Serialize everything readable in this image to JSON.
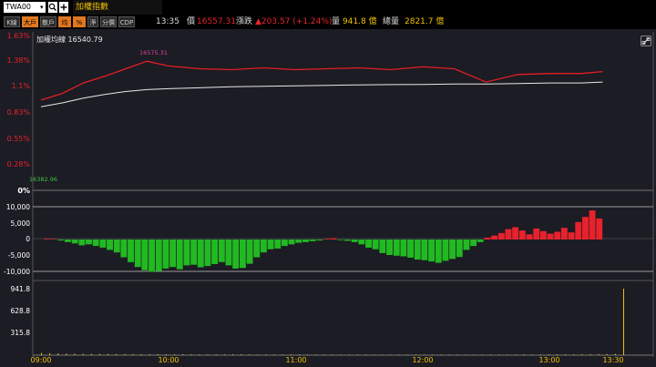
{
  "toolbar": {
    "symbol": "TWA00",
    "dropdown_glyph": "▾",
    "search_icon": "search-icon",
    "add_icon": "plus-icon",
    "index_name": "加權指數",
    "modes": [
      {
        "label": "K線",
        "active": false
      },
      {
        "label": "大戶",
        "active": true
      },
      {
        "label": "散戶",
        "active": false
      },
      {
        "label": "均",
        "active": true
      },
      {
        "label": "%",
        "active": true
      },
      {
        "label": "淨",
        "active": false
      },
      {
        "label": "分價",
        "active": false
      },
      {
        "label": "CDP",
        "active": false
      }
    ]
  },
  "quote": {
    "time": "13:35",
    "price_label": "價",
    "price": "16557.31",
    "change_label": "漲跌",
    "change": "▲203.57 (+1.24%)",
    "volume_label": "量",
    "volume": "941.8 億",
    "total_label": "總量",
    "total": "2821.7 億"
  },
  "colors": {
    "up": "#e8222c",
    "down": "#22b922",
    "line": "#e31e24",
    "avg": "#e8e8e8",
    "accent": "#f0c000"
  },
  "chart_data": [
    {
      "type": "line",
      "legend": "加權均線 16540.79",
      "y_ticks": [
        "1.63%",
        "1.38%",
        "1.1%",
        "0.83%",
        "0.55%",
        "0.28%"
      ],
      "baseline_label": "0%",
      "annotations": {
        "high": "16575.31",
        "low": "16382.96"
      },
      "x_ticks": [
        "09:00",
        "10:00",
        "11:00",
        "12:00",
        "13:00",
        "13:30"
      ],
      "series": [
        {
          "name": "加權指數",
          "x": [
            "09:00",
            "09:10",
            "09:20",
            "09:30",
            "09:40",
            "09:50",
            "10:00",
            "10:15",
            "10:30",
            "10:45",
            "11:00",
            "11:15",
            "11:30",
            "11:45",
            "12:00",
            "12:15",
            "12:30",
            "12:45",
            "13:00",
            "13:15",
            "13:25"
          ],
          "y": [
            0.95,
            1.02,
            1.13,
            1.2,
            1.28,
            1.36,
            1.31,
            1.28,
            1.27,
            1.29,
            1.27,
            1.28,
            1.29,
            1.27,
            1.3,
            1.28,
            1.14,
            1.22,
            1.23,
            1.23,
            1.25
          ]
        },
        {
          "name": "加權均線",
          "x": [
            "09:00",
            "09:10",
            "09:20",
            "09:30",
            "09:40",
            "09:50",
            "10:00",
            "10:15",
            "10:30",
            "10:45",
            "11:00",
            "11:15",
            "11:30",
            "11:45",
            "12:00",
            "12:15",
            "12:30",
            "12:45",
            "13:00",
            "13:15",
            "13:25"
          ],
          "y": [
            0.88,
            0.92,
            0.97,
            1.01,
            1.04,
            1.06,
            1.07,
            1.08,
            1.09,
            1.095,
            1.1,
            1.105,
            1.11,
            1.113,
            1.115,
            1.12,
            1.12,
            1.125,
            1.13,
            1.13,
            1.14
          ]
        }
      ]
    },
    {
      "type": "bar",
      "y_ticks": [
        "10,000",
        "5,000",
        "0",
        "-5,000",
        "-10,000"
      ],
      "ylim": [
        -12000,
        12000
      ],
      "values": [
        200,
        150,
        -300,
        -800,
        -1200,
        -1800,
        -1500,
        -2000,
        -2500,
        -3200,
        -4000,
        -5500,
        -7000,
        -8500,
        -9500,
        -10000,
        -9800,
        -9000,
        -8500,
        -9200,
        -8000,
        -7800,
        -8600,
        -8200,
        -7600,
        -7000,
        -8000,
        -9000,
        -8800,
        -7500,
        -5500,
        -4000,
        -3000,
        -2800,
        -2000,
        -1500,
        -1000,
        -800,
        -500,
        -300,
        200,
        400,
        -200,
        -400,
        -800,
        -1500,
        -2500,
        -3000,
        -4200,
        -4800,
        -5000,
        -5200,
        -5600,
        -6200,
        -6400,
        -6800,
        -7200,
        -6600,
        -6000,
        -5400,
        -3200,
        -2000,
        -800,
        600,
        1200,
        2000,
        3200,
        3800,
        2800,
        1600,
        3400,
        2600,
        1800,
        2400,
        3600,
        2200,
        5400,
        7000,
        9000,
        6500
      ]
    },
    {
      "type": "bar",
      "y_ticks": [
        "941.8",
        "628.8",
        "315.8"
      ],
      "ylim": [
        0,
        1000
      ],
      "values": [
        32,
        28,
        25,
        22,
        20,
        19,
        18,
        17,
        16,
        16,
        15,
        15,
        14,
        14,
        14,
        13,
        13,
        13,
        12,
        12,
        12,
        12,
        11,
        11,
        11,
        11,
        10,
        10,
        10,
        10,
        10,
        10,
        9,
        9,
        9,
        9,
        9,
        9,
        9,
        9,
        8,
        8,
        8,
        8,
        8,
        8,
        8,
        8,
        8,
        8,
        8,
        8,
        8,
        8,
        9,
        9,
        9,
        9,
        10,
        10,
        10,
        11,
        11,
        12,
        12,
        13,
        14,
        15,
        16,
        18,
        941.8
      ]
    }
  ]
}
